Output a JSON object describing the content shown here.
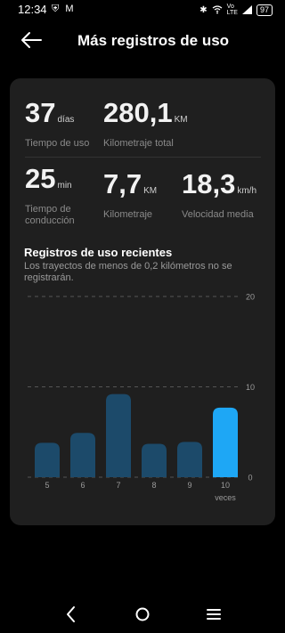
{
  "status": {
    "time": "12:34",
    "left_icons": [
      "shield-icon",
      "gmail-icon",
      "m-icon"
    ],
    "right_icons": [
      "bluetooth-icon",
      "wifi-icon",
      "volte-lte-icon",
      "signal-icon"
    ],
    "battery": "97"
  },
  "header": {
    "title": "Más registros de uso"
  },
  "stats": {
    "days": {
      "value": "37",
      "unit": "días",
      "label": "Tiempo de uso"
    },
    "total_km": {
      "value": "280,1",
      "unit": "KM",
      "label": "Kilometraje total"
    },
    "drive_time": {
      "value": "25",
      "unit": "min",
      "label": "Tiempo de conducción"
    },
    "km": {
      "value": "7,7",
      "unit": "KM",
      "label": "Kilometraje"
    },
    "avg_speed": {
      "value": "18,3",
      "unit": "km/h",
      "label": "Velocidad media"
    }
  },
  "recent": {
    "title": "Registros de uso recientes",
    "description": "Los trayectos de menos de 0,2 kilómetros no se registrarán."
  },
  "chart_data": {
    "type": "bar",
    "categories": [
      "5",
      "6",
      "7",
      "8",
      "9",
      "10"
    ],
    "values": [
      3.8,
      4.9,
      9.2,
      3.7,
      3.9,
      7.7
    ],
    "highlight_index": 5,
    "xlabel": "veces",
    "ylabel": "",
    "ylim": [
      0,
      20
    ],
    "yticks": [
      "0",
      "10",
      "20"
    ],
    "grid": true,
    "colors": {
      "bar": "#1c4a6a",
      "highlight": "#1ea7f5",
      "grid": "#555555",
      "tick": "#9a9a9a"
    }
  },
  "nav": {
    "icons": [
      "back-triangle-icon",
      "home-circle-icon",
      "menu-lines-icon"
    ]
  }
}
